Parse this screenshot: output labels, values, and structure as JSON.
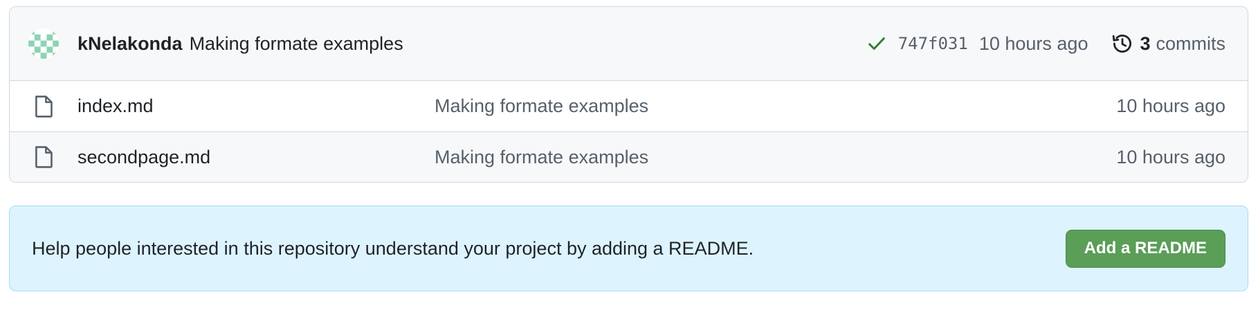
{
  "latest_commit": {
    "author": "kNelakonda",
    "message": "Making formate examples",
    "sha": "747f031",
    "time": "10 hours ago",
    "status_icon": "check-icon",
    "commit_count": "3",
    "commits_label": "commits"
  },
  "files": [
    {
      "name": "index.md",
      "message": "Making formate examples",
      "time": "10 hours ago",
      "icon": "file-icon"
    },
    {
      "name": "secondpage.md",
      "message": "Making formate examples",
      "time": "10 hours ago",
      "icon": "file-icon"
    }
  ],
  "readme_banner": {
    "text": "Help people interested in this repository understand your project by adding a README.",
    "button_label": "Add a README"
  },
  "colors": {
    "check": "#2f8132",
    "avatar": "#8dd3b4",
    "button": "#5a9e58",
    "banner": "#ddf4ff"
  }
}
